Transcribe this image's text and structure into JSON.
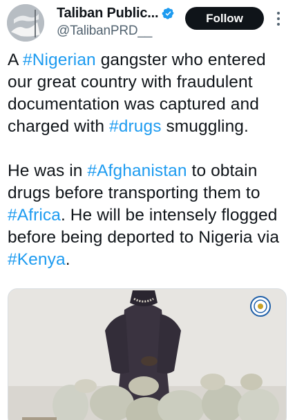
{
  "account": {
    "display_name": "Taliban Public...",
    "handle": "@TalibanPRD__",
    "verified": true,
    "avatar_icon": "avatar-flag-image",
    "verified_icon": "verified-badge-icon"
  },
  "actions": {
    "follow_label": "Follow",
    "more_icon": "more-options-icon"
  },
  "tweet": {
    "p1": [
      {
        "text": "A ",
        "hashtag": false
      },
      {
        "text": "#Nigerian",
        "hashtag": true
      },
      {
        "text": " gangster who entered our great country with fraudulent documentation was captured and charged with ",
        "hashtag": false
      },
      {
        "text": "#drugs",
        "hashtag": true
      },
      {
        "text": " smuggling.",
        "hashtag": false
      }
    ],
    "p2": [
      {
        "text": "He was in ",
        "hashtag": false
      },
      {
        "text": "#Afghanistan",
        "hashtag": true
      },
      {
        "text": " to obtain drugs before transporting them to ",
        "hashtag": false
      },
      {
        "text": "#Africa",
        "hashtag": true
      },
      {
        "text": ". He will be intensely flogged before being deported to Nigeria via ",
        "hashtag": false
      },
      {
        "text": "#Kenya",
        "hashtag": true
      },
      {
        "text": ".",
        "hashtag": false
      }
    ]
  },
  "colors": {
    "hashtag": "#1d9bf0",
    "text": "#0f1419",
    "secondary": "#536471",
    "follow_bg": "#0f1419",
    "verified": "#1d9bf0"
  },
  "media": {
    "description_icon": "attached-photo",
    "seal_icon": "ministry-seal-icon"
  }
}
